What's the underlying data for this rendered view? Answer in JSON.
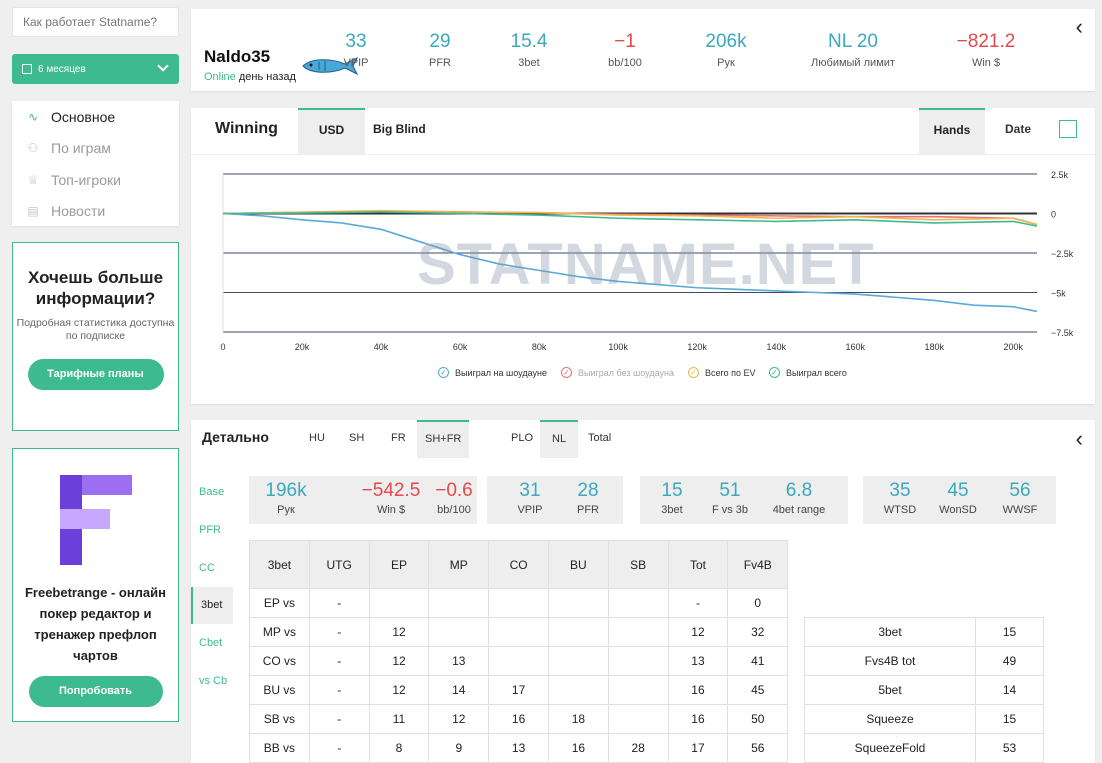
{
  "search": {
    "placeholder": "Как работает Statname?"
  },
  "period": {
    "label": "6 месяцев"
  },
  "nav": [
    {
      "icon": "pulse-icon",
      "label": "Основное",
      "active": true
    },
    {
      "icon": "cards-icon",
      "label": "По играм",
      "active": false
    },
    {
      "icon": "trophy-icon",
      "label": "Топ-игроки",
      "active": false
    },
    {
      "icon": "news-icon",
      "label": "Новости",
      "active": false
    }
  ],
  "promo": {
    "heading": "Хочешь больше информации?",
    "subtitle": "Подробная статистика доступна по подписке",
    "button": "Тарифные планы"
  },
  "promo2": {
    "logo_colors": [
      "#6b3fd9",
      "#9b6ef2",
      "#c6a8ff"
    ],
    "text": "Freebetrange - онлайн покер редактор и тренажер префлоп чартов",
    "button": "Попробовать"
  },
  "player": {
    "name": "Naldo35",
    "online": "Online",
    "ago": "день назад"
  },
  "top_stats": [
    {
      "value": "33",
      "label": "VPIP",
      "color": "teal"
    },
    {
      "value": "29",
      "label": "PFR",
      "color": "teal"
    },
    {
      "value": "15.4",
      "label": "3bet",
      "color": "teal"
    },
    {
      "value": "−1",
      "label": "bb/100",
      "color": "red"
    },
    {
      "value": "206k",
      "label": "Рук",
      "color": "teal"
    },
    {
      "value": "NL 20",
      "label": "Любимый лимит",
      "color": "teal"
    },
    {
      "value": "−821.2",
      "label": "Win $",
      "color": "red"
    }
  ],
  "chart_tabs": {
    "title": "Winning",
    "usd": "USD",
    "bb": "Big Blind",
    "hands": "Hands",
    "date": "Date"
  },
  "watermark": "STATNAME.NET",
  "chart_data": {
    "type": "line",
    "x_ticks": [
      "0",
      "20k",
      "40k",
      "60k",
      "80k",
      "100k",
      "120k",
      "140k",
      "160k",
      "180k",
      "200k"
    ],
    "y_ticks": [
      "2.5k",
      "0",
      "−2.5k",
      "−5k",
      "−7.5k"
    ],
    "xlim": [
      0,
      206000
    ],
    "ylim": [
      -7500,
      2500
    ],
    "series": [
      {
        "name": "Выиграл на шоудауне",
        "color": "#5aa9d6",
        "x": [
          0,
          10000,
          20000,
          30000,
          40000,
          50000,
          60000,
          70000,
          80000,
          90000,
          100000,
          110000,
          120000,
          130000,
          140000,
          150000,
          160000,
          170000,
          180000,
          190000,
          200000,
          206000
        ],
        "y": [
          0,
          -150,
          -400,
          -600,
          -1000,
          -1800,
          -2600,
          -3200,
          -3600,
          -4000,
          -4300,
          -4500,
          -4700,
          -4800,
          -4900,
          -5000,
          -5100,
          -5300,
          -5500,
          -5800,
          -5900,
          -6200
        ]
      },
      {
        "name": "Выиграл без шоудауна",
        "color": "#e57373",
        "x": [
          0,
          20000,
          40000,
          60000,
          80000,
          100000,
          120000,
          140000,
          160000,
          180000,
          200000,
          206000
        ],
        "y": [
          0,
          80,
          150,
          100,
          50,
          -50,
          -100,
          -150,
          -200,
          -200,
          -300,
          -700
        ]
      },
      {
        "name": "Всего по EV",
        "color": "#f0b450",
        "x": [
          0,
          20000,
          40000,
          60000,
          80000,
          100000,
          120000,
          140000,
          160000,
          180000,
          200000,
          206000
        ],
        "y": [
          0,
          80,
          180,
          100,
          50,
          -100,
          -150,
          -300,
          -200,
          -400,
          -300,
          -700
        ]
      },
      {
        "name": "Выиграл всего",
        "color": "#3dba8f",
        "x": [
          0,
          20000,
          40000,
          60000,
          80000,
          100000,
          120000,
          140000,
          160000,
          180000,
          200000,
          206000
        ],
        "y": [
          0,
          30,
          100,
          0,
          -100,
          -300,
          -400,
          -500,
          -400,
          -600,
          -500,
          -800
        ]
      }
    ]
  },
  "detail": {
    "title": "Детально",
    "tabs": [
      "HU",
      "SH",
      "FR",
      "SH+FR",
      "PLO",
      "NL",
      "Total"
    ],
    "side": [
      "Base",
      "PFR",
      "CC",
      "3bet",
      "Cbet",
      "vs Cb"
    ],
    "boxes": [
      [
        {
          "value": "196k",
          "label": "Рук",
          "color": "teal"
        },
        {
          "value": "−542.5",
          "label": "Win $",
          "color": "red"
        },
        {
          "value": "−0.6",
          "label": "bb/100",
          "color": "red"
        }
      ],
      [
        {
          "value": "31",
          "label": "VPIP",
          "color": "teal"
        },
        {
          "value": "28",
          "label": "PFR",
          "color": "teal"
        }
      ],
      [
        {
          "value": "15",
          "label": "3bet",
          "color": "teal"
        },
        {
          "value": "51",
          "label": "F vs 3b",
          "color": "teal"
        },
        {
          "value": "6.8",
          "label": "4bet range",
          "color": "teal"
        }
      ],
      [
        {
          "value": "35",
          "label": "WTSD",
          "color": "teal"
        },
        {
          "value": "45",
          "label": "WonSD",
          "color": "teal"
        },
        {
          "value": "56",
          "label": "WWSF",
          "color": "teal"
        }
      ]
    ],
    "table_head": [
      "3bet",
      "UTG",
      "EP",
      "MP",
      "CO",
      "BU",
      "SB",
      "Tot",
      "Fv4B"
    ],
    "table_rows": [
      [
        "EP vs",
        "-",
        "",
        "",
        "",
        "",
        "",
        "-",
        "0"
      ],
      [
        "MP vs",
        "-",
        "12",
        "",
        "",
        "",
        "",
        "12",
        "32"
      ],
      [
        "CO vs",
        "-",
        "12",
        "13",
        "",
        "",
        "",
        "13",
        "41"
      ],
      [
        "BU vs",
        "-",
        "12",
        "14",
        "17",
        "",
        "",
        "16",
        "45"
      ],
      [
        "SB vs",
        "-",
        "11",
        "12",
        "16",
        "18",
        "",
        "16",
        "50"
      ],
      [
        "BB vs",
        "-",
        "8",
        "9",
        "13",
        "16",
        "28",
        "17",
        "56"
      ]
    ],
    "summary": [
      [
        "3bet",
        "15"
      ],
      [
        "Fvs4B tot",
        "49"
      ],
      [
        "5bet",
        "14"
      ],
      [
        "Squeeze",
        "15"
      ],
      [
        "SqueezeFold",
        "53"
      ]
    ]
  }
}
